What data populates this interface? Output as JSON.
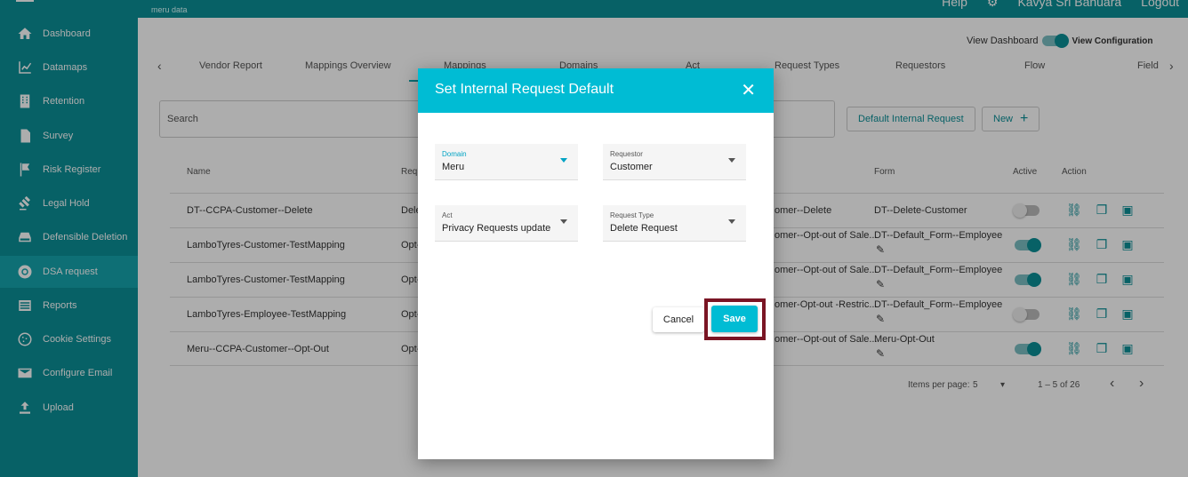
{
  "header": {
    "logo": "meru data",
    "help": "Help",
    "user": "Kavya Sri Banuara",
    "logout": "Logout"
  },
  "sidebar": {
    "items": [
      {
        "label": "Dashboard"
      },
      {
        "label": "Datamaps"
      },
      {
        "label": "Retention"
      },
      {
        "label": "Survey"
      },
      {
        "label": "Risk Register"
      },
      {
        "label": "Legal Hold"
      },
      {
        "label": "Defensible Deletion"
      },
      {
        "label": "DSA request"
      },
      {
        "label": "Reports"
      },
      {
        "label": "Cookie Settings"
      },
      {
        "label": "Configure Email"
      },
      {
        "label": "Upload"
      }
    ]
  },
  "view_toggle": {
    "left": "View Dashboard",
    "right": "View Configuration"
  },
  "tabs": [
    "Vendor Report",
    "Mappings Overview",
    "Mappings",
    "Domains",
    "Act",
    "Request Types",
    "Requestors",
    "Flow",
    "Field"
  ],
  "search": {
    "placeholder": "Search"
  },
  "buttons": {
    "default_internal": "Default Internal Request",
    "new": "New"
  },
  "table": {
    "headers": {
      "name": "Name",
      "req": "Requ",
      "form": "Form",
      "active": "Active",
      "action": "Action"
    },
    "rows": [
      {
        "name": "DT--CCPA-Customer--Delete",
        "req": "Dele",
        "mid": "omer--Delete",
        "form": "DT--Delete-Customer",
        "active": false
      },
      {
        "name": "LamboTyres-Customer-TestMapping",
        "req": "Opt-",
        "mid": "omer--Opt-out of Sale...",
        "form": "DT--Default_Form--Employee",
        "active": true
      },
      {
        "name": "LamboTyres-Customer-TestMapping",
        "req": "Opt-",
        "mid": "omer--Opt-out of Sale...",
        "form": "DT--Default_Form--Employee",
        "active": true
      },
      {
        "name": "LamboTyres-Employee-TestMapping",
        "req": "Opt-",
        "mid": "omer-Opt-out -Restric...",
        "form": "DT--Default_Form--Employee",
        "active": false
      },
      {
        "name": "Meru--CCPA-Customer--Opt-Out",
        "req": "Opt-",
        "mid": "omer--Opt-out of Sale...",
        "form": "Meru-Opt-Out",
        "active": true
      }
    ]
  },
  "pager": {
    "label": "Items per page:",
    "size": "5",
    "range": "1 – 5 of 26"
  },
  "modal": {
    "title": "Set Internal Request Default",
    "fields": {
      "domain": {
        "label": "Domain",
        "value": "Meru"
      },
      "requestor": {
        "label": "Requestor",
        "value": "Customer"
      },
      "act": {
        "label": "Act",
        "value": "Privacy Requests update"
      },
      "request_type": {
        "label": "Request Type",
        "value": "Delete Request"
      }
    },
    "cancel": "Cancel",
    "save": "Save"
  },
  "colors": {
    "sidebar": "#0b8f97",
    "modal_header": "#00bcd4",
    "highlight": "#7a1524"
  }
}
